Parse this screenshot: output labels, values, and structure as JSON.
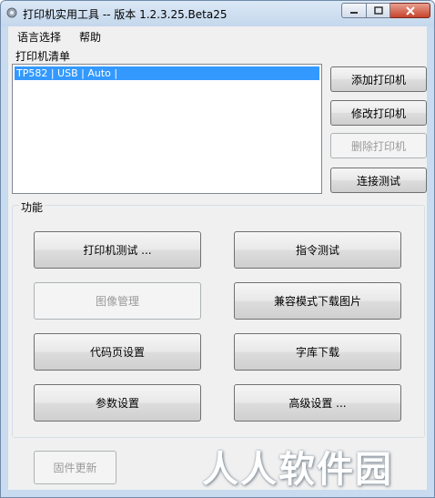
{
  "window": {
    "title": "打印机实用工具 -- 版本 1.2.3.25.Beta25"
  },
  "menu": [
    "语言选择",
    "帮助"
  ],
  "printer_list": {
    "label": "打印机清单",
    "items": [
      "TP582 | USB | Auto |"
    ]
  },
  "side_buttons": {
    "add": "添加打印机",
    "modify": "修改打印机",
    "delete": "删除打印机",
    "test_connection": "连接测试"
  },
  "functions": {
    "label": "功能",
    "printer_test": "打印机测试 ...",
    "command_test": "指令测试",
    "image_manage": "图像管理",
    "compat_download_image": "兼容模式下载图片",
    "codepage_settings": "代码页设置",
    "font_download": "字库下载",
    "param_settings": "参数设置",
    "advanced_settings": "高级设置 ..."
  },
  "footer": {
    "firmware_update": "固件更新",
    "watermark": "人人软件园"
  }
}
